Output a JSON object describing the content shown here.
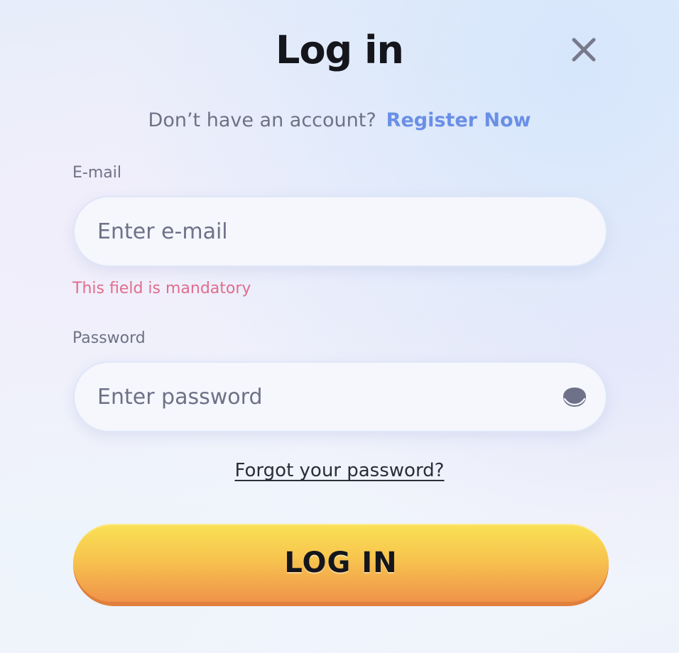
{
  "modal": {
    "title": "Log in",
    "close_icon": "close-icon"
  },
  "register": {
    "prompt": "Don’t have an account?",
    "link": "Register Now"
  },
  "email": {
    "label": "E-mail",
    "placeholder": "Enter e-mail",
    "value": "",
    "error": "This field is mandatory"
  },
  "password": {
    "label": "Password",
    "placeholder": "Enter password",
    "value": "",
    "toggle_icon": "eye-icon"
  },
  "forgot": {
    "link": "Forgot your password?"
  },
  "submit": {
    "label": "LOG IN"
  },
  "colors": {
    "accent_link": "#6a8fe6",
    "error": "#e06d8c",
    "button_top": "#fae156",
    "button_bottom": "#f0934a",
    "button_edge": "#e0803c",
    "title": "#14161c",
    "muted_text": "#6f7185"
  }
}
